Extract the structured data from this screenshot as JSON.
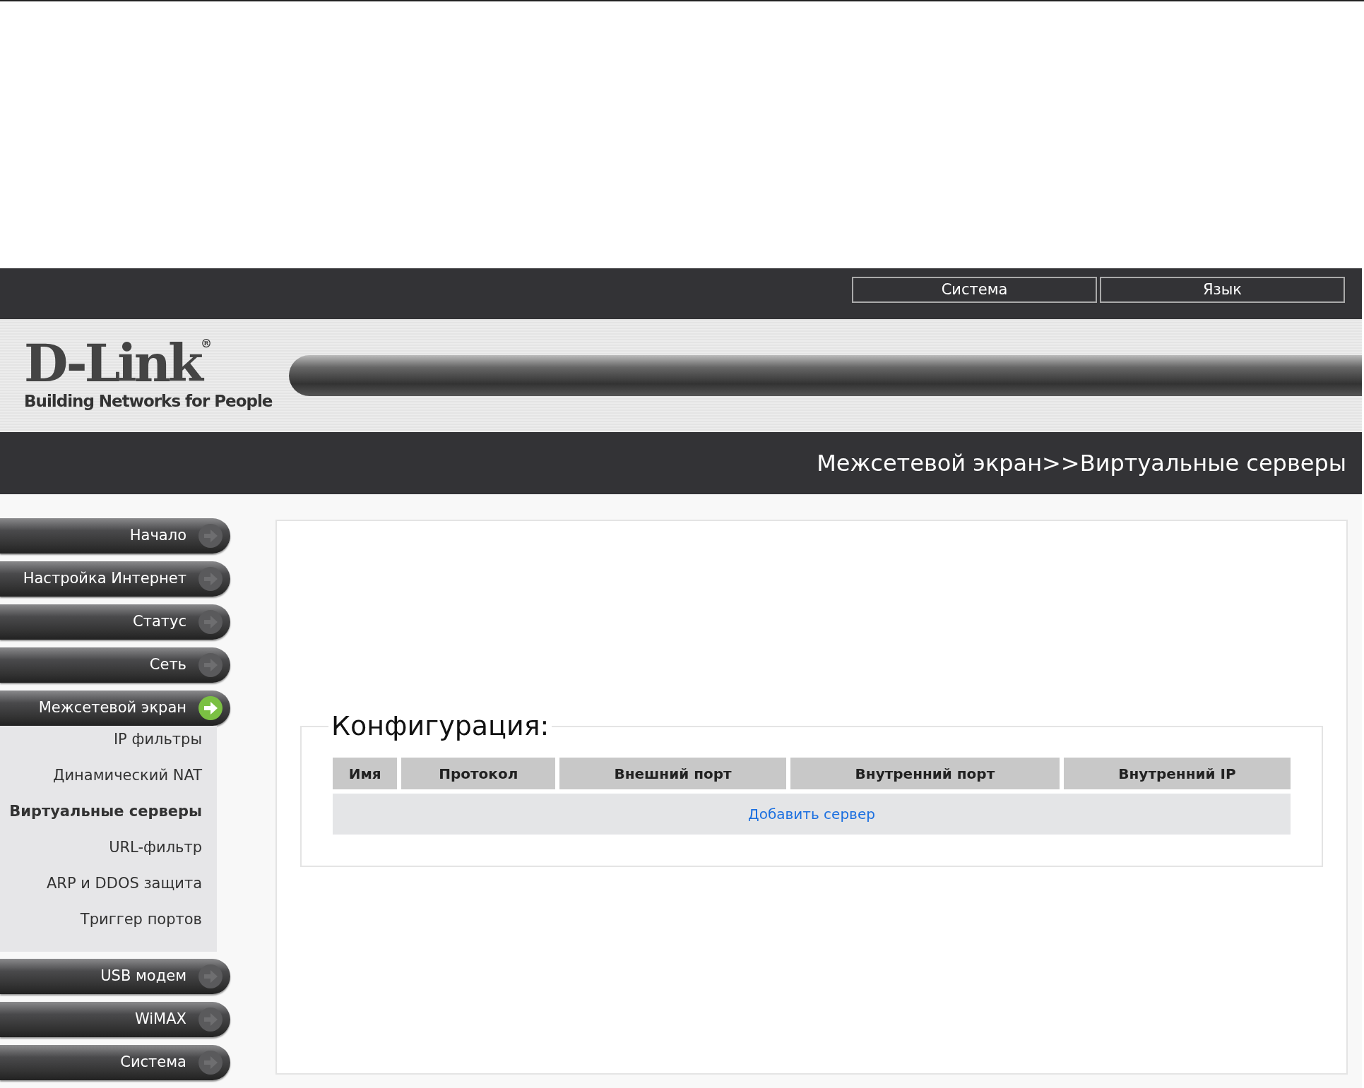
{
  "top_bar": {
    "buttons": [
      "Система",
      "Язык"
    ]
  },
  "logo": {
    "brand": "D-Link",
    "registered": "®",
    "tagline": "Building Networks for People"
  },
  "breadcrumb": "Межсетевой экран>>Виртуальные серверы",
  "sidebar": {
    "items": [
      {
        "label": "Начало",
        "expanded": false
      },
      {
        "label": "Настройка Интернет",
        "expanded": false
      },
      {
        "label": "Статус",
        "expanded": false
      },
      {
        "label": "Сеть",
        "expanded": false
      },
      {
        "label": "Межсетевой экран",
        "expanded": true,
        "children": [
          {
            "label": "IP фильтры",
            "selected": false
          },
          {
            "label": "Динамический NAT",
            "selected": false
          },
          {
            "label": "Виртуальные серверы",
            "selected": true
          },
          {
            "label": "URL-фильтр",
            "selected": false
          },
          {
            "label": "ARP и DDOS защита",
            "selected": false
          },
          {
            "label": "Триггер портов",
            "selected": false
          }
        ]
      },
      {
        "label": "USB модем",
        "expanded": false
      },
      {
        "label": "WiMAX",
        "expanded": false
      },
      {
        "label": "Система",
        "expanded": false
      }
    ]
  },
  "section": {
    "title": "Конфигурация:",
    "table": {
      "columns": [
        "Имя",
        "Протокол",
        "Внешний порт",
        "Внутренний порт",
        "Внутренний IP"
      ],
      "add_link": "Добавить сервер"
    }
  }
}
